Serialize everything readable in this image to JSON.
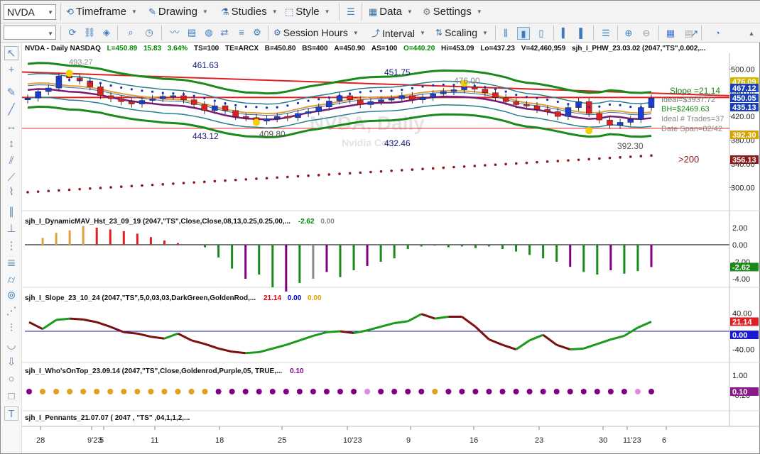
{
  "toolbar1": {
    "symbol": "NVDA",
    "menus": [
      {
        "label": "Timeframe",
        "icon": "timeframe-icon"
      },
      {
        "label": "Drawing",
        "icon": "drawing-icon"
      },
      {
        "label": "Studies",
        "icon": "studies-icon"
      },
      {
        "label": "Style",
        "icon": "style-icon"
      },
      {
        "label": "Data",
        "icon": "data-icon"
      },
      {
        "label": "Settings",
        "icon": "gear-icon"
      }
    ]
  },
  "toolbar2": {
    "session_hours": "Session Hours",
    "interval": "Interval",
    "scaling": "Scaling"
  },
  "header": {
    "title": "NVDA - Daily  NASDAQ",
    "L": "L=450.89",
    "change": "15.83",
    "pct": "3.64%",
    "TS": "TS=100",
    "TE": "TE=ARCX",
    "B": "B=450.80",
    "BS": "BS=400",
    "A": "A=450.90",
    "AS": "AS=100",
    "O": "O=440.20",
    "Hi": "Hi=453.09",
    "Lo": "Lo=437.23",
    "V": "V=42,460,959",
    "study": "sjh_I_PHW_23.03.02 (2047,\"TS\",0.002,..."
  },
  "price_pane": {
    "watermark_title": "NVDA, Daily",
    "watermark_sub": "Nvidia Corp",
    "annotations": [
      "461.63",
      "451.75",
      "443.12",
      "409.80",
      "432.46",
      "392.30",
      "476.00",
      "493.27"
    ],
    "right_labels": {
      "slope": "Slope =21.14",
      "ideal": "Ideal=$3937.72",
      "bh": "BH=$2469.63",
      "ideal_trades": "Ideal # Trades=37",
      "date_span": "Date Span=82/42",
      "gt200": ">200"
    },
    "y_ticks": [
      "500.00",
      "460.00",
      "420.00",
      "380.00",
      "340.00",
      "300.00"
    ],
    "badges": [
      {
        "text": "476.09",
        "color": "#d4b800"
      },
      {
        "text": "467.12",
        "color": "#1a3fb5"
      },
      {
        "text": "450.05",
        "color": "#1a3fb5"
      },
      {
        "text": "435.13",
        "color": "#1a3fb5"
      },
      {
        "text": "392.30",
        "color": "#d4a200"
      },
      {
        "text": "356.13",
        "color": "#8b1a1a"
      }
    ]
  },
  "pane2": {
    "title": "sjh_I_DynamicMAV_Hst_23_09_19 (2047,\"TS\",Close,Close,08,13,0.25,0.25,00,...",
    "v1": "-2.62",
    "v2": "0.00",
    "y_ticks": [
      "2.00",
      "0.00",
      "-2.00",
      "-4.00"
    ],
    "badge": "-2.62"
  },
  "pane3": {
    "title": "sjh_I_Slope_23_10_24 (2047,\"TS\",5,0,03,03,DarkGreen,GoldenRod,...",
    "v1": "21.14",
    "v2": "0.00",
    "v3": "0.00",
    "y_ticks": [
      "40.00",
      "-40.00"
    ],
    "badges": [
      "21.14",
      "0.00"
    ]
  },
  "pane4": {
    "title": "sjh_I_Who'sOnTop_23.09.14 (2047,\"TS\",Close,Goldenrod,Purple,05,  TRUE,...",
    "v1": "0.10",
    "y_ticks": [
      "1.00",
      "-0.20"
    ],
    "badge": "0.10"
  },
  "pane5": {
    "title": "sjh_I_Pennants_21.07.07 (  2047 , \"TS\" ,04,1,1,2,..."
  },
  "x_axis": [
    "28",
    "9'23",
    "5",
    "11",
    "18",
    "25",
    "10'23",
    "9",
    "16",
    "23",
    "30",
    "11'23",
    "6"
  ],
  "chart_data": {
    "type": "candlestick",
    "symbol": "NVDA",
    "interval": "Daily",
    "ohlc_close_approx": [
      451,
      462,
      468,
      488,
      485,
      480,
      470,
      455,
      450,
      445,
      441,
      447,
      450,
      454,
      455,
      448,
      440,
      430,
      438,
      430,
      420,
      418,
      412,
      416,
      420,
      418,
      425,
      428,
      436,
      446,
      455,
      448,
      440,
      445,
      448,
      450,
      455,
      448,
      452,
      458,
      462,
      465,
      470,
      466,
      460,
      452,
      445,
      440,
      438,
      432,
      428,
      420,
      435,
      445,
      425,
      414,
      405,
      410,
      415,
      435,
      451
    ],
    "ylim": [
      280,
      510
    ],
    "dynamic_mav_hist": [
      0,
      0.8,
      1.4,
      1.7,
      2.2,
      2.0,
      1.8,
      1.6,
      1.3,
      0.9,
      0.5,
      0.2,
      0,
      -0.3,
      -1.5,
      -2.8,
      -4.0,
      -3.5,
      -5.0,
      -5.5,
      -4.5,
      -4.0,
      -3.2,
      -3.8,
      -3.0,
      -2.5,
      -2.0,
      -1.6,
      -0.5,
      -0.2,
      -0.1,
      -0.3,
      -0.2,
      -0.4,
      -0.2,
      -0.5,
      -0.8,
      -1.2,
      -1.6,
      -2.0,
      -2.6,
      -3.2,
      -3.5,
      -3.0,
      -3.4,
      -3.1,
      -2.62
    ],
    "slope": [
      20,
      5,
      25,
      28,
      26,
      20,
      10,
      -2,
      -5,
      -12,
      -16,
      -5,
      -20,
      -28,
      -38,
      -45,
      -48,
      -46,
      -38,
      -30,
      -20,
      -10,
      -2,
      0,
      -4,
      2,
      10,
      18,
      22,
      38,
      28,
      32,
      32,
      10,
      -18,
      -30,
      -40,
      -20,
      -8,
      -30,
      -40,
      -38,
      -28,
      -18,
      -10,
      8,
      21.14
    ],
    "whos_on_top_colors": [
      "purple",
      "goldenrod",
      "goldenrod",
      "goldenrod",
      "goldenrod",
      "goldenrod",
      "goldenrod",
      "goldenrod",
      "goldenrod",
      "goldenrod",
      "goldenrod",
      "goldenrod",
      "goldenrod",
      "goldenrod",
      "purple",
      "purple",
      "purple",
      "purple",
      "purple",
      "purple",
      "purple",
      "purple",
      "purple",
      "purple",
      "purple",
      "plum",
      "purple",
      "purple",
      "purple",
      "purple",
      "goldenrod",
      "purple",
      "purple",
      "purple",
      "purple",
      "purple",
      "purple",
      "purple",
      "purple",
      "purple",
      "purple",
      "purple",
      "purple",
      "purple",
      "purple",
      "plum",
      "purple"
    ]
  }
}
